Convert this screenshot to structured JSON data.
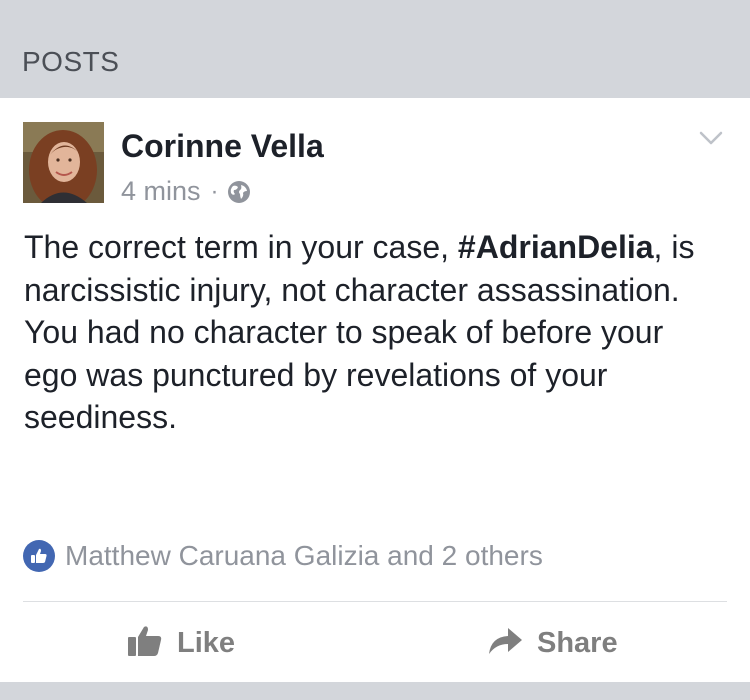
{
  "section": {
    "title": "POSTS"
  },
  "post": {
    "author": "Corinne Vella",
    "time": "4 mins",
    "separator": "·",
    "text_pre": "The correct term in your case, ",
    "hashtag": "#AdrianDelia",
    "text_post": ", is narcissistic injury, not character assassination. You had no character to speak of before your ego was punctured by revelations of your seediness.",
    "reactions": "Matthew Caruana Galizia and 2 others",
    "actions": {
      "like": "Like",
      "share": "Share"
    }
  },
  "icons": {
    "privacy": "globe-icon",
    "options": "chevron-down-icon",
    "reaction": "thumbs-up-icon",
    "like": "thumbs-up-icon",
    "share": "share-arrow-icon"
  },
  "colors": {
    "background": "#d3d6db",
    "card": "#ffffff",
    "text": "#1d2129",
    "muted": "#90949c",
    "brand": "#4267b2",
    "action": "#7f7f7f"
  }
}
